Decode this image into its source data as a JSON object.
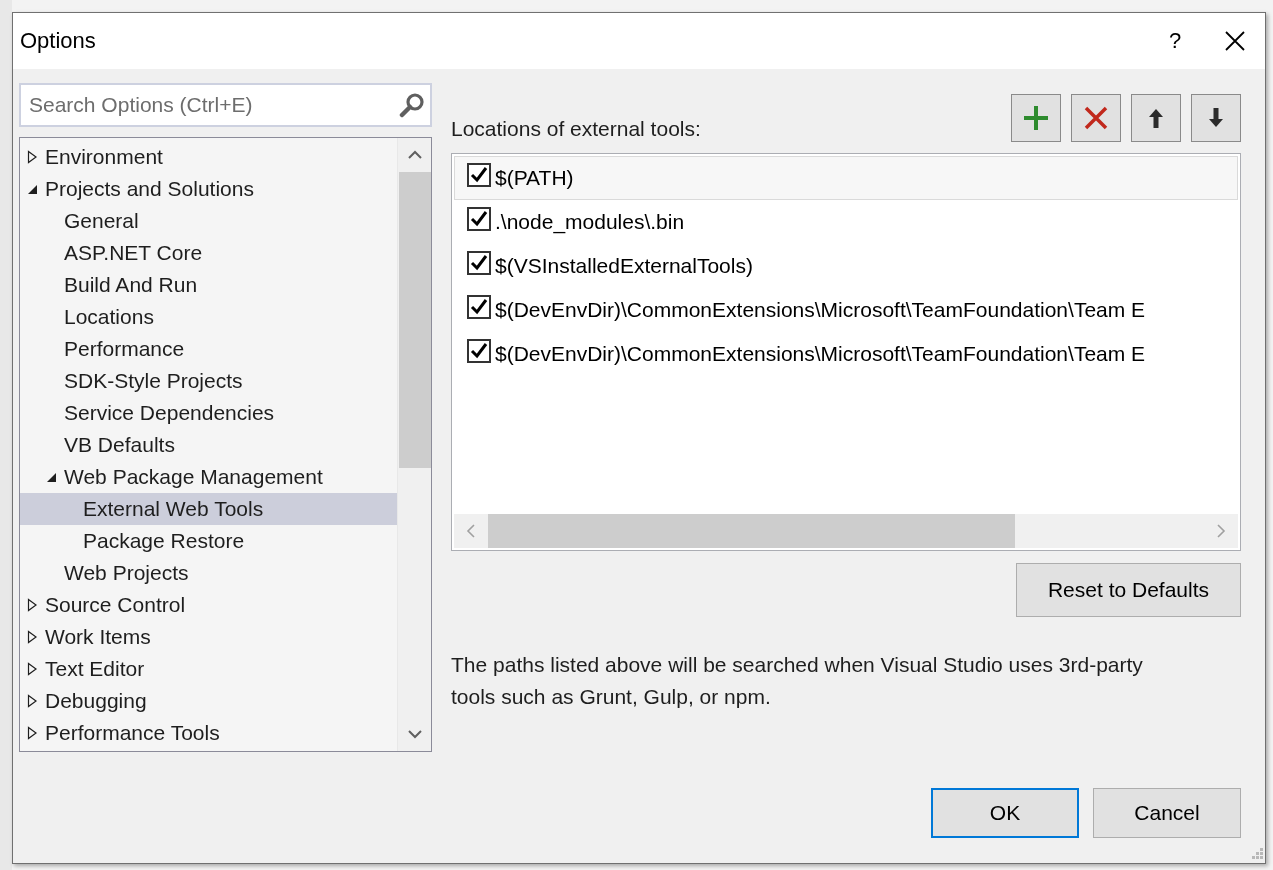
{
  "window": {
    "title": "Options",
    "help": "?"
  },
  "search": {
    "placeholder": "Search Options (Ctrl+E)"
  },
  "tree": [
    {
      "label": "Environment",
      "kind": "folder",
      "expanded": false,
      "selected": false
    },
    {
      "label": "Projects and Solutions",
      "kind": "folder",
      "expanded": true,
      "selected": false,
      "children": [
        {
          "label": "General",
          "kind": "page",
          "selected": false
        },
        {
          "label": "ASP.NET Core",
          "kind": "page",
          "selected": false
        },
        {
          "label": "Build And Run",
          "kind": "page",
          "selected": false
        },
        {
          "label": "Locations",
          "kind": "page",
          "selected": false
        },
        {
          "label": "Performance",
          "kind": "page",
          "selected": false
        },
        {
          "label": "SDK-Style Projects",
          "kind": "page",
          "selected": false
        },
        {
          "label": "Service Dependencies",
          "kind": "page",
          "selected": false
        },
        {
          "label": "VB Defaults",
          "kind": "page",
          "selected": false
        },
        {
          "label": "Web Package Management",
          "kind": "folder",
          "expanded": true,
          "selected": false,
          "children": [
            {
              "label": "External Web Tools",
              "kind": "page",
              "selected": true
            },
            {
              "label": "Package Restore",
              "kind": "page",
              "selected": false
            }
          ]
        },
        {
          "label": "Web Projects",
          "kind": "page",
          "selected": false
        }
      ]
    },
    {
      "label": "Source Control",
      "kind": "folder",
      "expanded": false,
      "selected": false
    },
    {
      "label": "Work Items",
      "kind": "folder",
      "expanded": false,
      "selected": false
    },
    {
      "label": "Text Editor",
      "kind": "folder",
      "expanded": false,
      "selected": false
    },
    {
      "label": "Debugging",
      "kind": "folder",
      "expanded": false,
      "selected": false
    },
    {
      "label": "Performance Tools",
      "kind": "folder",
      "expanded": false,
      "selected": false
    }
  ],
  "locations": {
    "label": "Locations of external tools:",
    "toolbar": [
      {
        "kind": "add"
      },
      {
        "kind": "remove"
      },
      {
        "kind": "up"
      },
      {
        "kind": "down"
      }
    ],
    "items": [
      {
        "path": "$(PATH)",
        "checked": true,
        "selected": true
      },
      {
        "path": ".\\node_modules\\.bin",
        "checked": true,
        "selected": false
      },
      {
        "path": "$(VSInstalledExternalTools)",
        "checked": true,
        "selected": false
      },
      {
        "path": "$(DevEnvDir)\\CommonExtensions\\Microsoft\\TeamFoundation\\Team E",
        "checked": true,
        "selected": false
      },
      {
        "path": "$(DevEnvDir)\\CommonExtensions\\Microsoft\\TeamFoundation\\Team E",
        "checked": true,
        "selected": false
      }
    ],
    "reset_button": "Reset to Defaults",
    "description": "The paths listed above will be searched when Visual Studio uses 3rd-party tools such as Grunt, Gulp, or npm."
  },
  "buttons": [
    {
      "label": "OK",
      "default": true
    },
    {
      "label": "Cancel",
      "default": false
    }
  ]
}
